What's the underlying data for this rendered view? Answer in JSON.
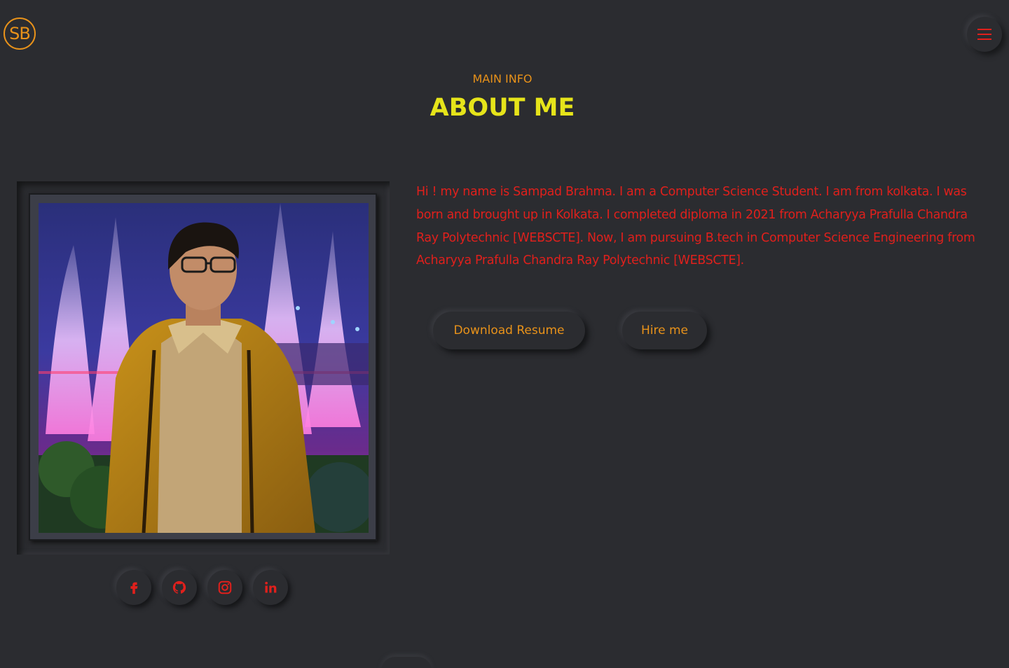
{
  "header": {
    "logo_text": "SB",
    "menu_icon": "hamburger-menu-icon"
  },
  "section": {
    "subtitle": "MAIN INFO",
    "title": "ABOUT ME"
  },
  "about": {
    "description": "Hi ! my name is Sampad Brahma. I am a Computer Science Student. I am from kolkata. I was born and brought up in Kolkata. I completed diploma in 2021 from Acharyya Prafulla Chandra Ray Polytechnic [WEBSCTE]. Now, I am pursuing B.tech in Computer Science Engineering from Acharyya Prafulla Chandra Ray Polytechnic [WEBSCTE].",
    "download_label": "Download Resume",
    "hire_label": "Hire me"
  },
  "profile_photo": "profile-photo",
  "socials": [
    {
      "icon": "facebook-icon"
    },
    {
      "icon": "github-icon"
    },
    {
      "icon": "instagram-icon"
    },
    {
      "icon": "linkedin-icon"
    }
  ],
  "colors": {
    "background": "#2b2c30",
    "accent_orange": "#e8921a",
    "title_yellow": "#e6e41a",
    "text_red": "#e0201c"
  }
}
